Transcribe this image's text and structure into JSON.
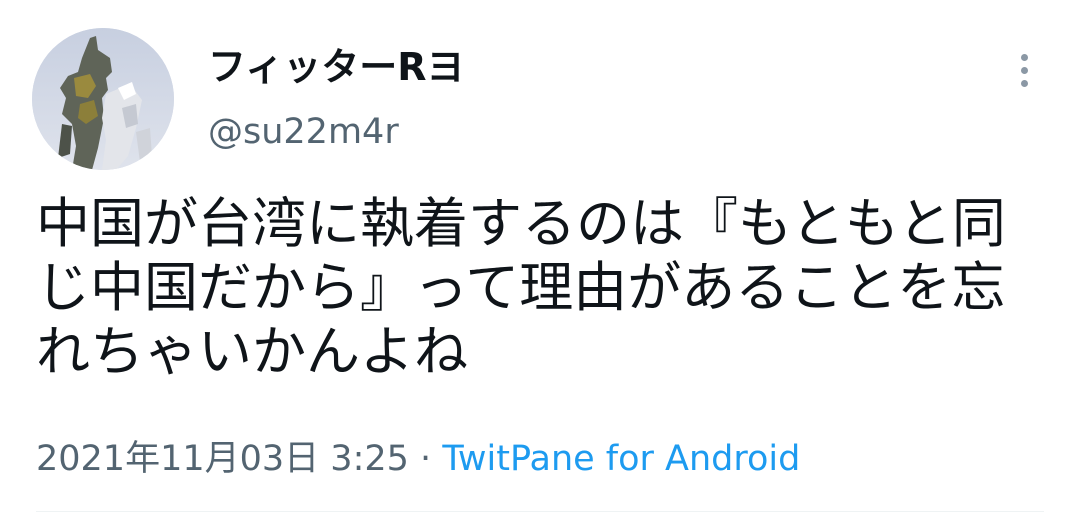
{
  "author": {
    "display_name": "フィッターRヨ",
    "handle": "@su22m4r"
  },
  "tweet": {
    "text": "中国が台湾に執着するのは『もともと同じ中国だから』って理由があることを忘れちゃいかんよね",
    "date": "2021年11月03日",
    "time": "3:25",
    "separator": "·",
    "client": "TwitPane for Android"
  },
  "menu": {
    "icon": "more-vertical-icon"
  },
  "colors": {
    "text_primary": "#0f1419",
    "text_secondary": "#536471",
    "link": "#1d9bf0",
    "divider": "#eff3f4"
  }
}
